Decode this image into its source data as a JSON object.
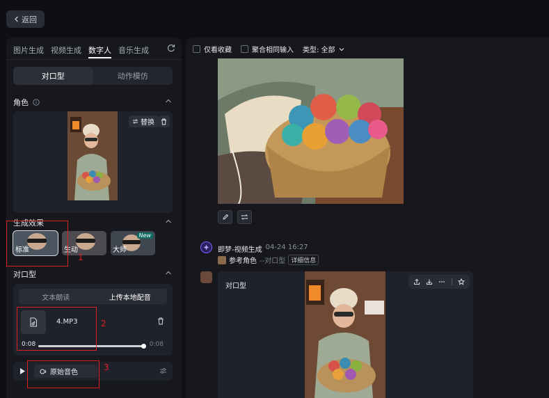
{
  "header": {
    "back_label": "返回"
  },
  "left_panel": {
    "tabs": [
      {
        "label": "图片生成",
        "active": false
      },
      {
        "label": "视频生成",
        "active": false
      },
      {
        "label": "数字人",
        "active": true
      },
      {
        "label": "音乐生成",
        "active": false
      }
    ],
    "mode_options": [
      {
        "label": "对口型",
        "active": true
      },
      {
        "label": "动作模仿",
        "active": false
      }
    ],
    "role_section": {
      "title": "角色",
      "replace_label": "替换"
    },
    "effect_section": {
      "title": "生成效果",
      "effects": [
        {
          "label": "标准",
          "selected": true
        },
        {
          "label": "生动",
          "selected": false
        },
        {
          "label": "大师",
          "selected": false,
          "badge": "New"
        }
      ]
    },
    "lipsync_section": {
      "title": "对口型",
      "audio_tabs": [
        {
          "label": "文本朗读",
          "active": false
        },
        {
          "label": "上传本地配音",
          "active": true
        }
      ],
      "file_name": "4.MP3",
      "time_current": "0:08",
      "time_total": "0:08",
      "progress": 1.0,
      "voice_label": "原始音色"
    }
  },
  "annotations": [
    "1",
    "2",
    "3"
  ],
  "right_panel": {
    "filters": {
      "favorites_label": "仅看收藏",
      "merge_label": "聚合相同输入",
      "type_label": "类型: 全部"
    },
    "message": {
      "title": "即梦-视频生成",
      "time": "04-24 16:27",
      "ref_label": "参考角色",
      "ref_sub": "--对口型",
      "detail_label": "详细信息",
      "video_label": "对口型"
    }
  },
  "colors": {
    "accent_purple": "#7a62ff",
    "annotation_red": "#e02020"
  }
}
